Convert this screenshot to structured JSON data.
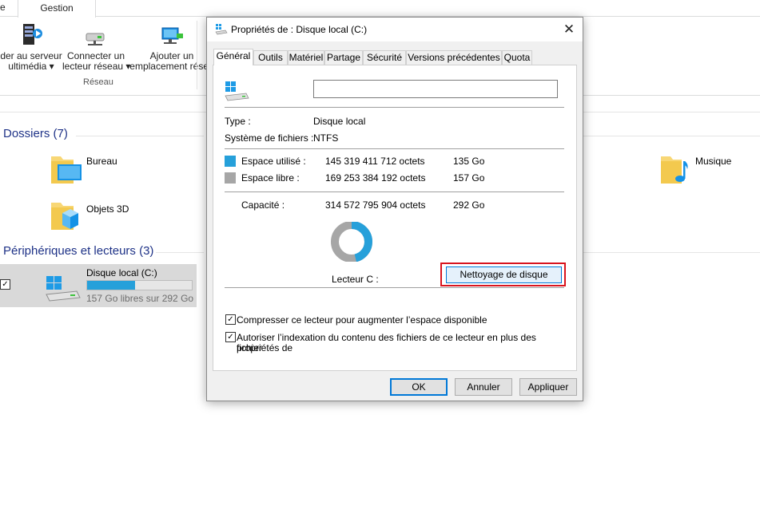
{
  "explorer": {
    "ribbon_tab_partial": "e",
    "ribbon_tab_gestion": "Gestion",
    "ribbon_buttons": {
      "media_server_line1": "der au serveur",
      "media_server_line2": "ultimédia ▾",
      "map_drive_line1": "Connecter un",
      "map_drive_line2": "lecteur réseau ▾",
      "add_location_line1": "Ajouter un",
      "add_location_line2": "emplacement résea"
    },
    "ribbon_group_label": "Réseau",
    "folders_header": "Dossiers (7)",
    "folders": {
      "bureau": "Bureau",
      "objets3d": "Objets 3D",
      "musique": "Musique"
    },
    "devices_header": "Périphériques et lecteurs (3)",
    "drive": {
      "name": "Disque local (C:)",
      "free_text": "157 Go libres sur 292 Go",
      "used_fraction": 0.46,
      "checked": "✓"
    }
  },
  "dialog": {
    "title": "Propriétés de : Disque local (C:)",
    "close_glyph": "✕",
    "tabs": [
      "Général",
      "Outils",
      "Matériel",
      "Partage",
      "Sécurité",
      "Versions précédentes",
      "Quota"
    ],
    "name_value": "",
    "type_label": "Type :",
    "type_value": "Disque local",
    "fs_label": "Système de fichiers :",
    "fs_value": "NTFS",
    "used_label": "Espace utilisé :",
    "used_bytes": "145 319 411 712 octets",
    "used_size": "135 Go",
    "free_label": "Espace libre :",
    "free_bytes": "169 253 384 192 octets",
    "free_size": "157 Go",
    "capacity_label": "Capacité :",
    "capacity_bytes": "314 572 795 904 octets",
    "capacity_size": "292 Go",
    "used_fraction": 0.462,
    "drive_label": "Lecteur C :",
    "cleanup_button": "Nettoyage de disque",
    "compress_label": "Compresser ce lecteur pour augmenter l’espace disponible",
    "index_label_line1": "Autoriser l’indexation du contenu des fichiers de ce lecteur en plus des propriétés de",
    "index_label_line2": "fichier",
    "check_glyph": "✓",
    "ok_button": "OK",
    "cancel_button": "Annuler",
    "apply_button": "Appliquer"
  },
  "colors": {
    "used": "#26a0da",
    "free": "#a6a6a6",
    "section_header": "#1e3287",
    "highlight": "#d9141e"
  }
}
